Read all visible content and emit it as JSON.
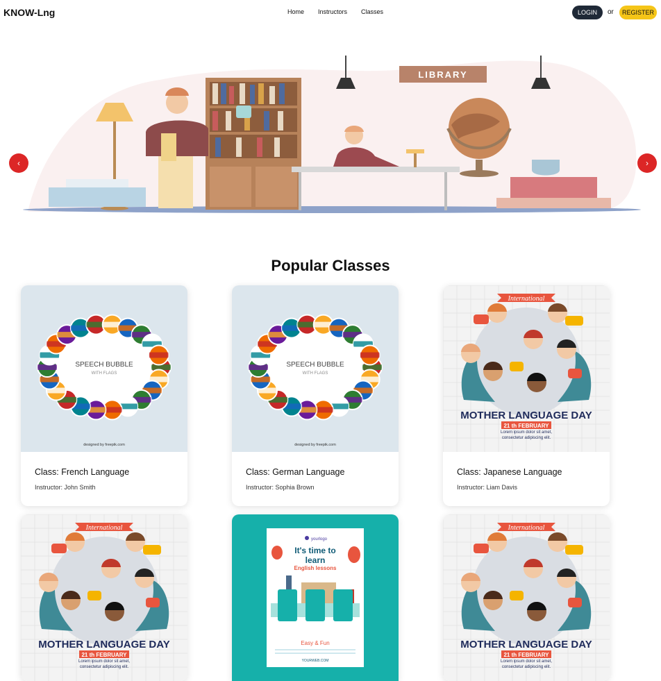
{
  "nav": {
    "brand": "KNOW-Lng",
    "items": [
      "Home",
      "Instructors",
      "Classes"
    ],
    "login": "LOGIN",
    "or": "or",
    "register": "REGISTER"
  },
  "hero": {
    "sign": "LIBRARY",
    "prev_icon": "chevron-left-icon",
    "next_icon": "chevron-right-icon",
    "prev_glyph": "‹",
    "next_glyph": "›"
  },
  "section_title": "Popular Classes",
  "cards": [
    {
      "class_label": "Class: French Language",
      "instructor": "Instructor: John Smith",
      "image": {
        "type": "flags",
        "title": "SPEECH BUBBLE",
        "subtitle": "WITH FLAGS",
        "credit": "designed by freepik.com"
      }
    },
    {
      "class_label": "Class: German Language",
      "instructor": "Instructor: Sophia Brown",
      "image": {
        "type": "flags",
        "title": "SPEECH BUBBLE",
        "subtitle": "WITH FLAGS",
        "credit": "designed by freepik.com"
      }
    },
    {
      "class_label": "Class: Japanese Language",
      "instructor": "Instructor: Liam Davis",
      "image": {
        "type": "mother",
        "banner": "International",
        "title": "MOTHER LANGUAGE DAY",
        "date": "21 th FEBRUARY",
        "lorem": "Lorem ipsum dolor sit amet, consectetur adipiscing elit."
      }
    },
    {
      "image": {
        "type": "mother",
        "banner": "International",
        "title": "MOTHER LANGUAGE DAY",
        "date": "21 th FEBRUARY",
        "lorem": "Lorem ipsum dolor sit amet, consectetur adipiscing elit."
      }
    },
    {
      "image": {
        "type": "poster",
        "logo": "yourlogo",
        "l1": "It's time to",
        "l2": "learn",
        "l3": "English lessons",
        "tag": "Easy & Fun",
        "site": "YOURWEB.COM"
      }
    },
    {
      "image": {
        "type": "mother",
        "banner": "International",
        "title": "MOTHER LANGUAGE DAY",
        "date": "21 th FEBRUARY",
        "lorem": "Lorem ipsum dolor sit amet, consectetur adipiscing elit."
      }
    }
  ],
  "colors": {
    "dark_button": "#1f2937",
    "register_button": "#f5c518",
    "arrow": "#dc2626",
    "card_teal": "#16b0aa",
    "flags_bg": "#dce6ed",
    "mother_bg": "#f3f3f3"
  }
}
